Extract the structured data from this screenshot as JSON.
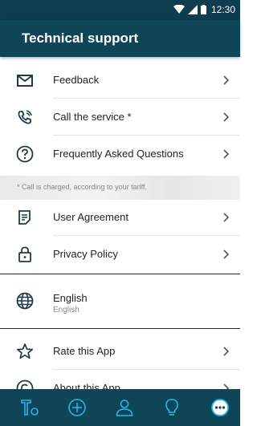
{
  "status_bar": {
    "time": "12:30"
  },
  "app_bar": {
    "title": "Technical support"
  },
  "menu": {
    "feedback": "Feedback",
    "call_service": "Call the service *",
    "faq": "Frequently Asked Questions",
    "note": "* Call is charged, according to your tariff.",
    "user_agreement": "User Agreement",
    "privacy_policy": "Privacy Policy",
    "language": {
      "label": "English",
      "value": "English"
    },
    "rate_app": "Rate this App",
    "about_app": "About this App"
  },
  "bottom_nav": {
    "items": [
      {
        "icon": "tools-icon",
        "active": false
      },
      {
        "icon": "plus-circle-icon",
        "active": false
      },
      {
        "icon": "profile-icon",
        "active": false
      },
      {
        "icon": "lightbulb-icon",
        "active": false
      },
      {
        "icon": "more-icon",
        "active": true
      }
    ]
  },
  "colors": {
    "header": "#0e4658",
    "status_bar": "#0d3d4e",
    "nav_icon": "#27b7e6",
    "text": "#222222"
  }
}
